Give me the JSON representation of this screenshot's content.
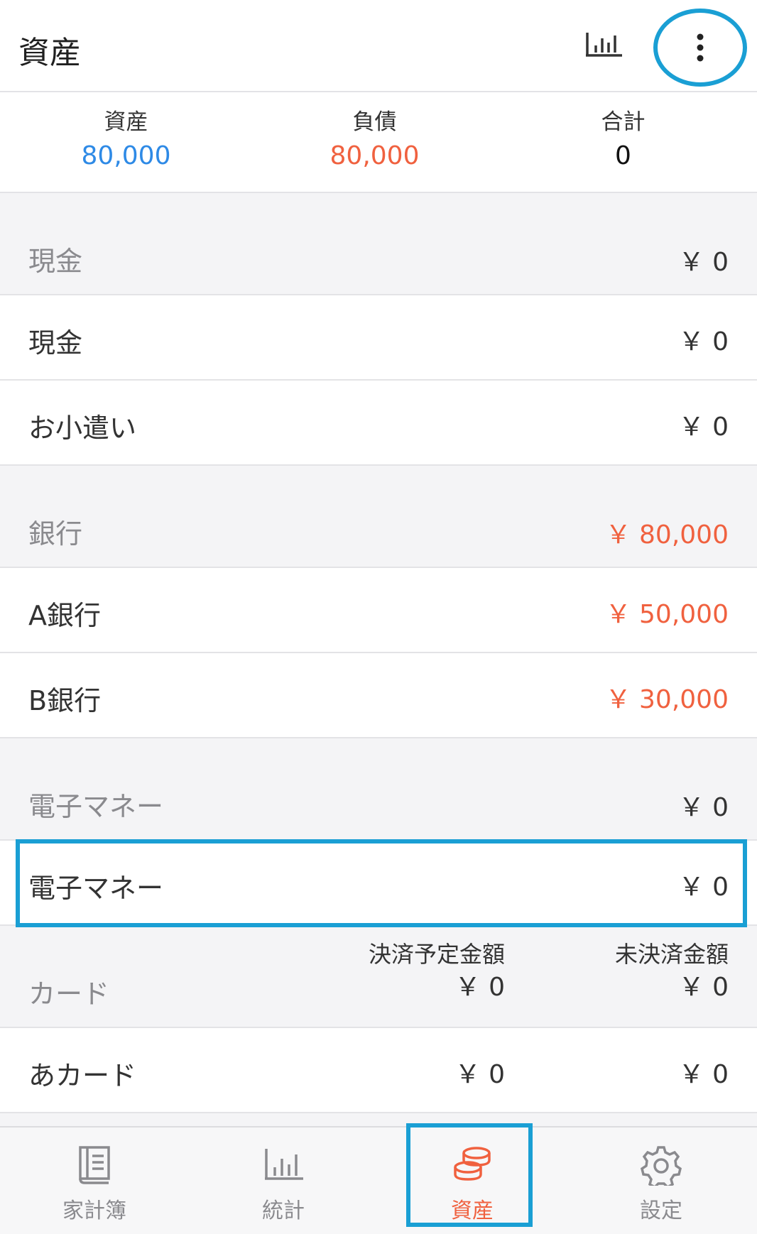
{
  "header": {
    "title": "資産",
    "chart_icon": "bar-chart-icon",
    "more_icon": "more-vertical-icon"
  },
  "summary": {
    "assets": {
      "label": "資産",
      "value": "80,000",
      "color": "#2e8ae6"
    },
    "liabilities": {
      "label": "負債",
      "value": "80,000",
      "color": "#f0613f"
    },
    "total": {
      "label": "合計",
      "value": "0"
    }
  },
  "sections": {
    "cash": {
      "name": "現金",
      "amount": "￥ 0",
      "items": [
        {
          "name": "現金",
          "amount": "￥ 0"
        },
        {
          "name": "お小遣い",
          "amount": "￥ 0"
        }
      ]
    },
    "bank": {
      "name": "銀行",
      "amount": "￥ 80,000",
      "items": [
        {
          "name": "A銀行",
          "amount": "￥ 50,000"
        },
        {
          "name": "B銀行",
          "amount": "￥ 30,000"
        }
      ]
    },
    "emoney": {
      "name": "電子マネー",
      "amount": "￥ 0",
      "items": [
        {
          "name": "電子マネー",
          "amount": "￥ 0"
        }
      ]
    },
    "card": {
      "name": "カード",
      "scheduled_label": "決済予定金額",
      "scheduled_amount": "￥ 0",
      "unsettled_label": "未決済金額",
      "unsettled_amount": "￥ 0",
      "items": [
        {
          "name": "あカード",
          "scheduled": "￥ 0",
          "unsettled": "￥ 0"
        }
      ]
    }
  },
  "tabs": [
    {
      "label": "家計簿",
      "icon": "book-icon"
    },
    {
      "label": "統計",
      "icon": "bar-chart-icon"
    },
    {
      "label": "資産",
      "icon": "coins-icon",
      "active": true
    },
    {
      "label": "設定",
      "icon": "gear-icon"
    }
  ],
  "colors": {
    "accent_red": "#f0613f",
    "accent_blue": "#2e8ae6",
    "highlight": "#1a9fd4"
  }
}
